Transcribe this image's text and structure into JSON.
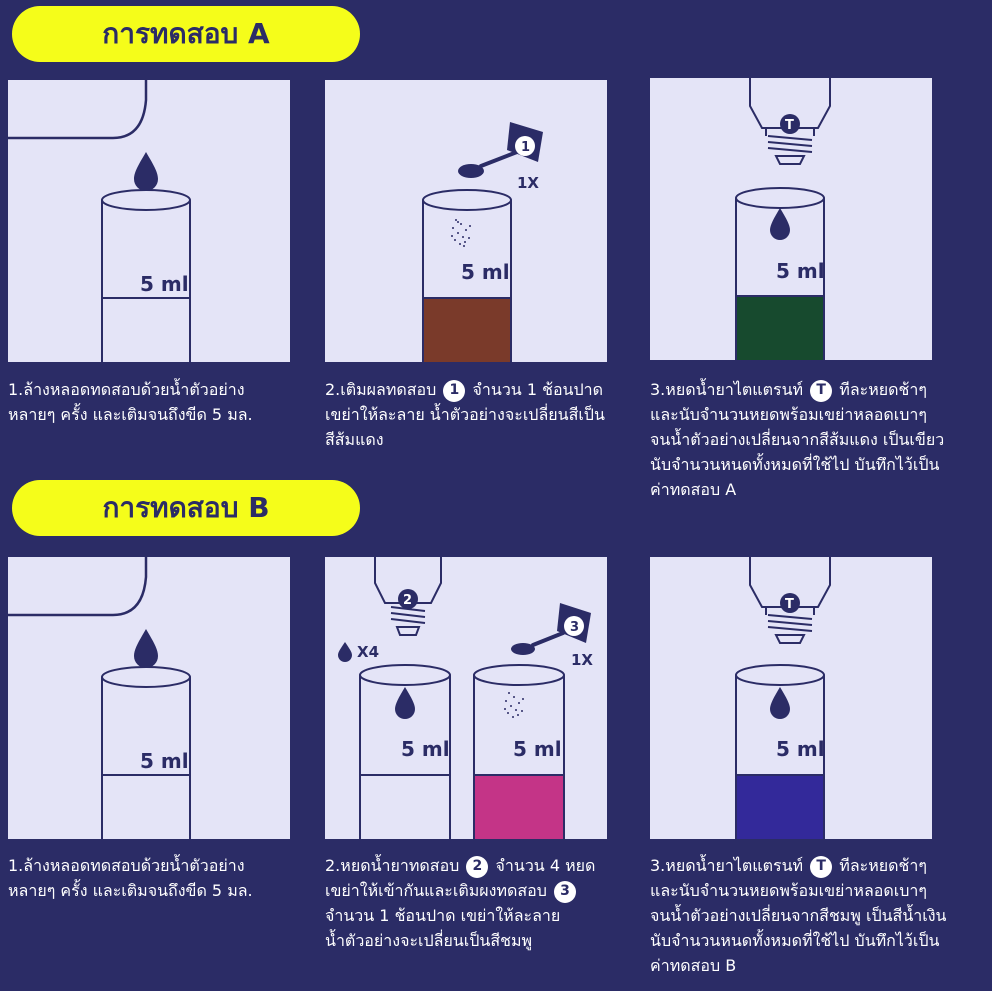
{
  "sections": [
    {
      "title": "การทดสอบ A",
      "steps": [
        {
          "lines": [
            "1.ล้างหลอดทดสอบด้วยน้ำตัวอย่าง",
            "หลายๆ ครั้ง และเติมจนถึงขีด 5 มล."
          ]
        },
        {
          "lines": [
            "2.เติมผลทดสอบ",
            "จำนวน 1 ช้อนปาด",
            "เขย่าให้ละลาย น้ำตัวอย่างจะเปลี่ยนสีเป็น",
            "สีส้มแดง"
          ],
          "badge": "1"
        },
        {
          "lines": [
            "3.หยดน้ำยาไตแตรนท์",
            "ทีละหยดช้าๆ",
            "และนับจำนวนหยดพร้อมเขย่าหลอดเบาๆ",
            "จนน้ำตัวอย่างเปลี่ยนจากสีส้มแดง เป็นเขียว",
            "นับจำนวนหนดทั้งหมดที่ใช้ไป บันทึกไว้เป็น",
            "ค่าทดสอบ A"
          ],
          "badge": "T"
        }
      ]
    },
    {
      "title": "การทดสอบ B",
      "steps": [
        {
          "lines": [
            "1.ล้างหลอดทดสอบด้วยน้ำตัวอย่าง",
            "หลายๆ ครั้ง และเติมจนถึงขีด 5 มล."
          ]
        },
        {
          "lines": [
            "2.หยดน้ำยาทดสอบ",
            "จำนวน 4 หยด",
            "เขย่าให้เข้ากันและเติมผงทดสอบ",
            "จำนวน 1 ช้อนปาด เขย่าให้ละลาย",
            "น้ำตัวอย่างจะเปลี่ยนเป็นสีชมพู"
          ],
          "badge": "2",
          "badge2": "3"
        },
        {
          "lines": [
            "3.หยดน้ำยาไตแตรนท์",
            "ทีละหยดช้าๆ",
            "และนับจำนวนหยดพร้อมเขย่าหลอดเบาๆ",
            "จนน้ำตัวอย่างเปลี่ยนจากสีชมพู เป็นสีน้ำเงิน",
            "นับจำนวนหนดทั้งหมดที่ใช้ไป บันทึกไว้เป็น",
            "ค่าทดสอบ B"
          ],
          "badge": "T"
        }
      ]
    }
  ],
  "labels": {
    "volume": "5 ml",
    "scoop_qty": "1X",
    "drops_qty": "X4",
    "badge_1": "1",
    "badge_2": "2",
    "badge_3": "3",
    "badge_t": "T"
  },
  "colors": {
    "background": "#2b2c66",
    "banner": "#f5fd1a",
    "panel": "#e4e4f7",
    "ink": "#2b2c66",
    "liquid_brown": "#7a3a2a",
    "liquid_green": "#174a2e",
    "liquid_pink": "#c43487",
    "liquid_blue": "#33299a"
  },
  "icons": [
    "water-drop-icon",
    "measuring-spoon-icon",
    "reagent-sachet-icon",
    "dropper-bottle-icon",
    "test-tube-icon",
    "powder-particles-icon"
  ]
}
